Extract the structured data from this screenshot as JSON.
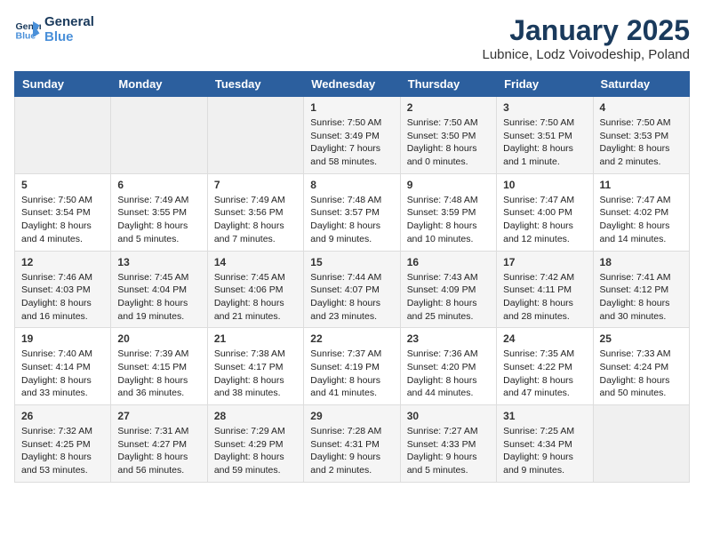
{
  "header": {
    "logo_line1": "General",
    "logo_line2": "Blue",
    "title": "January 2025",
    "subtitle": "Lubnice, Lodz Voivodeship, Poland"
  },
  "weekdays": [
    "Sunday",
    "Monday",
    "Tuesday",
    "Wednesday",
    "Thursday",
    "Friday",
    "Saturday"
  ],
  "weeks": [
    [
      {
        "num": "",
        "info": ""
      },
      {
        "num": "",
        "info": ""
      },
      {
        "num": "",
        "info": ""
      },
      {
        "num": "1",
        "info": "Sunrise: 7:50 AM\nSunset: 3:49 PM\nDaylight: 7 hours\nand 58 minutes."
      },
      {
        "num": "2",
        "info": "Sunrise: 7:50 AM\nSunset: 3:50 PM\nDaylight: 8 hours\nand 0 minutes."
      },
      {
        "num": "3",
        "info": "Sunrise: 7:50 AM\nSunset: 3:51 PM\nDaylight: 8 hours\nand 1 minute."
      },
      {
        "num": "4",
        "info": "Sunrise: 7:50 AM\nSunset: 3:53 PM\nDaylight: 8 hours\nand 2 minutes."
      }
    ],
    [
      {
        "num": "5",
        "info": "Sunrise: 7:50 AM\nSunset: 3:54 PM\nDaylight: 8 hours\nand 4 minutes."
      },
      {
        "num": "6",
        "info": "Sunrise: 7:49 AM\nSunset: 3:55 PM\nDaylight: 8 hours\nand 5 minutes."
      },
      {
        "num": "7",
        "info": "Sunrise: 7:49 AM\nSunset: 3:56 PM\nDaylight: 8 hours\nand 7 minutes."
      },
      {
        "num": "8",
        "info": "Sunrise: 7:48 AM\nSunset: 3:57 PM\nDaylight: 8 hours\nand 9 minutes."
      },
      {
        "num": "9",
        "info": "Sunrise: 7:48 AM\nSunset: 3:59 PM\nDaylight: 8 hours\nand 10 minutes."
      },
      {
        "num": "10",
        "info": "Sunrise: 7:47 AM\nSunset: 4:00 PM\nDaylight: 8 hours\nand 12 minutes."
      },
      {
        "num": "11",
        "info": "Sunrise: 7:47 AM\nSunset: 4:02 PM\nDaylight: 8 hours\nand 14 minutes."
      }
    ],
    [
      {
        "num": "12",
        "info": "Sunrise: 7:46 AM\nSunset: 4:03 PM\nDaylight: 8 hours\nand 16 minutes."
      },
      {
        "num": "13",
        "info": "Sunrise: 7:45 AM\nSunset: 4:04 PM\nDaylight: 8 hours\nand 19 minutes."
      },
      {
        "num": "14",
        "info": "Sunrise: 7:45 AM\nSunset: 4:06 PM\nDaylight: 8 hours\nand 21 minutes."
      },
      {
        "num": "15",
        "info": "Sunrise: 7:44 AM\nSunset: 4:07 PM\nDaylight: 8 hours\nand 23 minutes."
      },
      {
        "num": "16",
        "info": "Sunrise: 7:43 AM\nSunset: 4:09 PM\nDaylight: 8 hours\nand 25 minutes."
      },
      {
        "num": "17",
        "info": "Sunrise: 7:42 AM\nSunset: 4:11 PM\nDaylight: 8 hours\nand 28 minutes."
      },
      {
        "num": "18",
        "info": "Sunrise: 7:41 AM\nSunset: 4:12 PM\nDaylight: 8 hours\nand 30 minutes."
      }
    ],
    [
      {
        "num": "19",
        "info": "Sunrise: 7:40 AM\nSunset: 4:14 PM\nDaylight: 8 hours\nand 33 minutes."
      },
      {
        "num": "20",
        "info": "Sunrise: 7:39 AM\nSunset: 4:15 PM\nDaylight: 8 hours\nand 36 minutes."
      },
      {
        "num": "21",
        "info": "Sunrise: 7:38 AM\nSunset: 4:17 PM\nDaylight: 8 hours\nand 38 minutes."
      },
      {
        "num": "22",
        "info": "Sunrise: 7:37 AM\nSunset: 4:19 PM\nDaylight: 8 hours\nand 41 minutes."
      },
      {
        "num": "23",
        "info": "Sunrise: 7:36 AM\nSunset: 4:20 PM\nDaylight: 8 hours\nand 44 minutes."
      },
      {
        "num": "24",
        "info": "Sunrise: 7:35 AM\nSunset: 4:22 PM\nDaylight: 8 hours\nand 47 minutes."
      },
      {
        "num": "25",
        "info": "Sunrise: 7:33 AM\nSunset: 4:24 PM\nDaylight: 8 hours\nand 50 minutes."
      }
    ],
    [
      {
        "num": "26",
        "info": "Sunrise: 7:32 AM\nSunset: 4:25 PM\nDaylight: 8 hours\nand 53 minutes."
      },
      {
        "num": "27",
        "info": "Sunrise: 7:31 AM\nSunset: 4:27 PM\nDaylight: 8 hours\nand 56 minutes."
      },
      {
        "num": "28",
        "info": "Sunrise: 7:29 AM\nSunset: 4:29 PM\nDaylight: 8 hours\nand 59 minutes."
      },
      {
        "num": "29",
        "info": "Sunrise: 7:28 AM\nSunset: 4:31 PM\nDaylight: 9 hours\nand 2 minutes."
      },
      {
        "num": "30",
        "info": "Sunrise: 7:27 AM\nSunset: 4:33 PM\nDaylight: 9 hours\nand 5 minutes."
      },
      {
        "num": "31",
        "info": "Sunrise: 7:25 AM\nSunset: 4:34 PM\nDaylight: 9 hours\nand 9 minutes."
      },
      {
        "num": "",
        "info": ""
      }
    ]
  ]
}
